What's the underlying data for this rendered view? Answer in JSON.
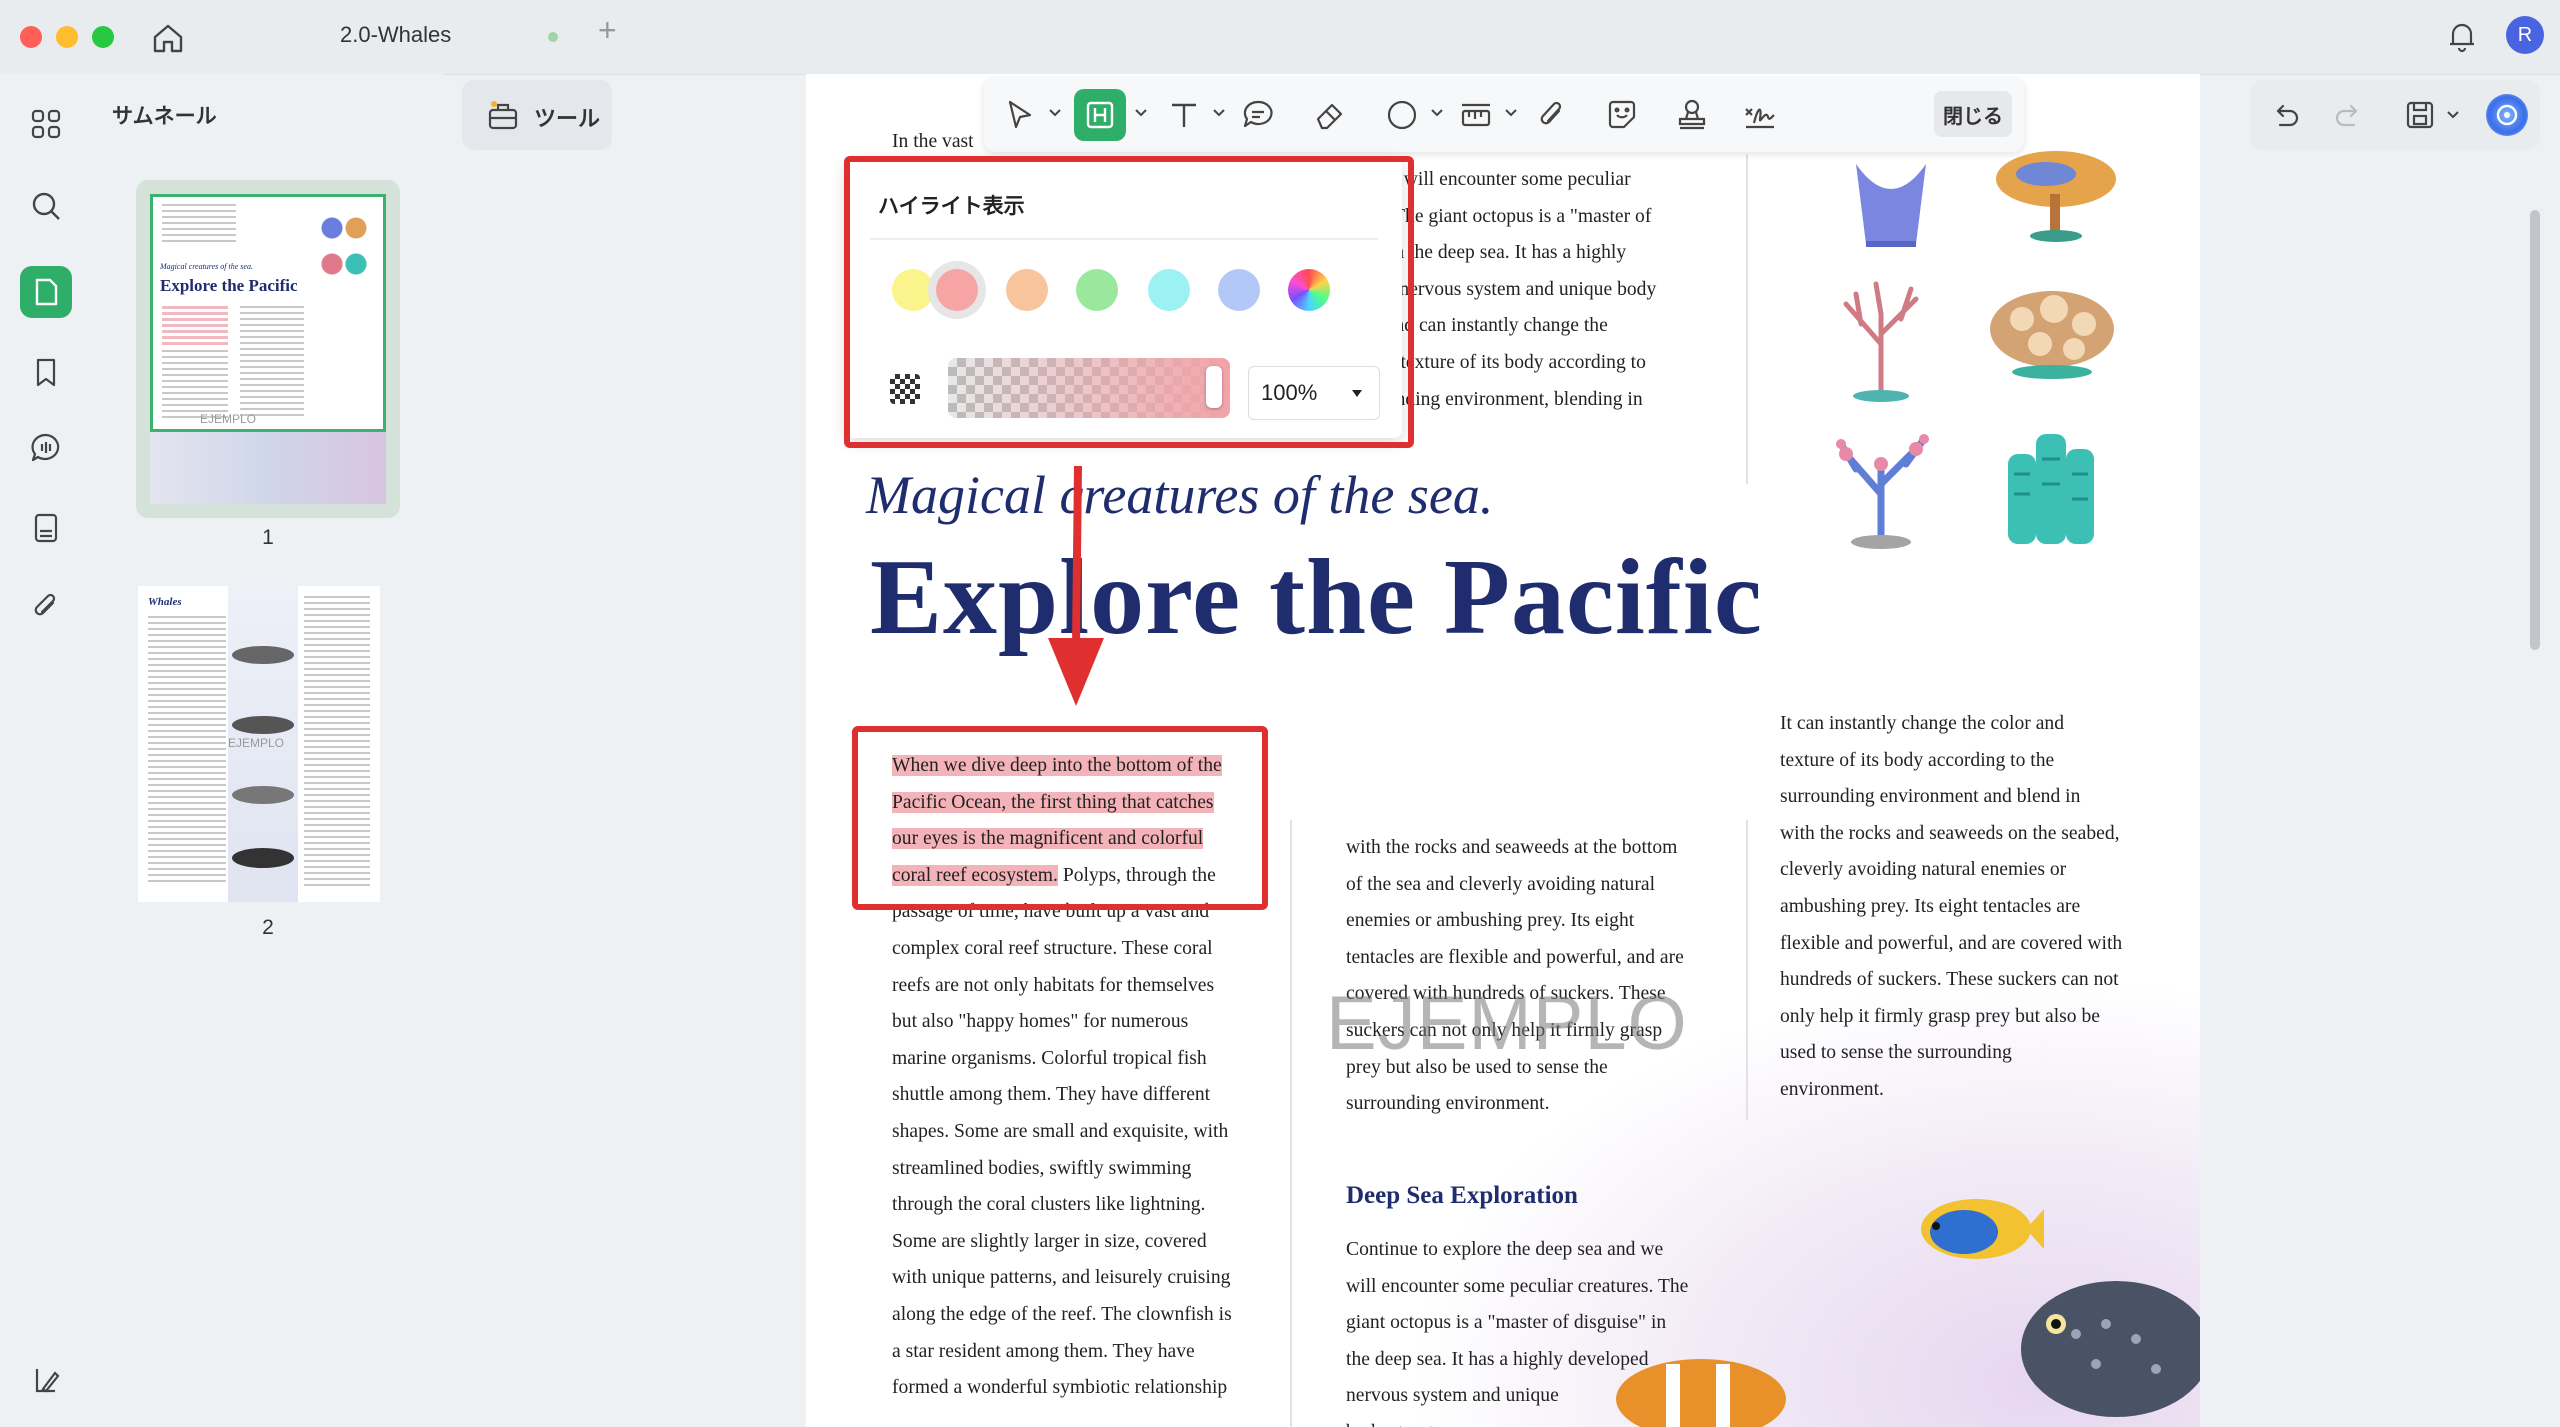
{
  "window": {
    "tab_title": "2.0-Whales"
  },
  "thumbnails": {
    "title": "サムネール",
    "pages": [
      {
        "number": "1"
      },
      {
        "number": "2"
      }
    ]
  },
  "tools": {
    "label": "ツール"
  },
  "toolbar": {
    "close_label": "閉じる"
  },
  "avatar": {
    "initial": "R"
  },
  "highlight_popup": {
    "title": "ハイライト表示",
    "colors": [
      "#fbf38c",
      "#f6a4a4",
      "#f8c49e",
      "#9ae89c",
      "#9cf2f2",
      "#b4c8f8"
    ],
    "selected_color_index": 1,
    "opacity": "100%"
  },
  "colors": {
    "accent": "#2fae6a",
    "title_navy": "#1f2d6e",
    "annotation_red": "#e02f2f"
  },
  "document": {
    "top_col1_line1": "In the vast",
    "top_col2_lines": [
      "we will encounter some peculiar",
      "s. The giant octopus is a \"master of",
      "\" in the deep sea. It has a highly",
      "ed nervous system and unique body",
      ", and can instantly change the",
      "nd texture of its body according to",
      "ounding environment, blending in"
    ],
    "subtitle": "Magical creatures of the sea.",
    "title": "Explore the Pacific",
    "col1_highlighted": [
      "When we dive deep into the bottom of the",
      "Pacific Ocean, the first thing that catches",
      "our eyes is the magnificent and colorful",
      "coral reef ecosystem."
    ],
    "col1_after_highlight": "Polyps, through the",
    "col1_lines": [
      "passage of time, have built up a vast and",
      "complex coral reef structure. These coral",
      "reefs are not only habitats for themselves",
      "but also \"happy homes\" for numerous",
      "marine organisms. Colorful tropical fish",
      "shuttle among them. They have different",
      "shapes. Some are small and exquisite, with",
      "streamlined bodies, swiftly swimming",
      "through the coral clusters like lightning.",
      "Some are slightly larger in size, covered",
      "with unique patterns, and leisurely cruising",
      "along the edge of the reef. The clownfish is",
      "a star resident among them. They have",
      "formed a wonderful symbiotic relationship"
    ],
    "col2_lines": [
      "with the rocks and seaweeds at the bottom",
      "of the sea and cleverly avoiding natural",
      "enemies or ambushing prey. Its eight",
      "tentacles are flexible and powerful, and are",
      "covered with hundreds of suckers. These",
      "suckers can not only help it firmly grasp",
      "prey but also be used to sense the",
      "surrounding environment."
    ],
    "watermark": "EJEMPLO",
    "section_heading": "Deep Sea Exploration",
    "col2_section_lines": [
      "Continue to explore the deep sea and we",
      "will encounter some peculiar creatures. The",
      "giant octopus is a \"master of disguise\" in",
      "the deep sea. It has a highly developed",
      "nervous system and unique",
      "body structure."
    ],
    "col3_lines": [
      "It can instantly change the color and",
      "texture of its body according to the",
      "surrounding environment and blend in",
      "with the rocks and seaweeds on the seabed,",
      "cleverly avoiding natural enemies or",
      "ambushing prey. Its eight tentacles are",
      "flexible and powerful, and are covered with",
      "hundreds of suckers. These suckers can not",
      "only help it firmly grasp prey but also be",
      "used to sense the surrounding",
      "environment."
    ]
  }
}
